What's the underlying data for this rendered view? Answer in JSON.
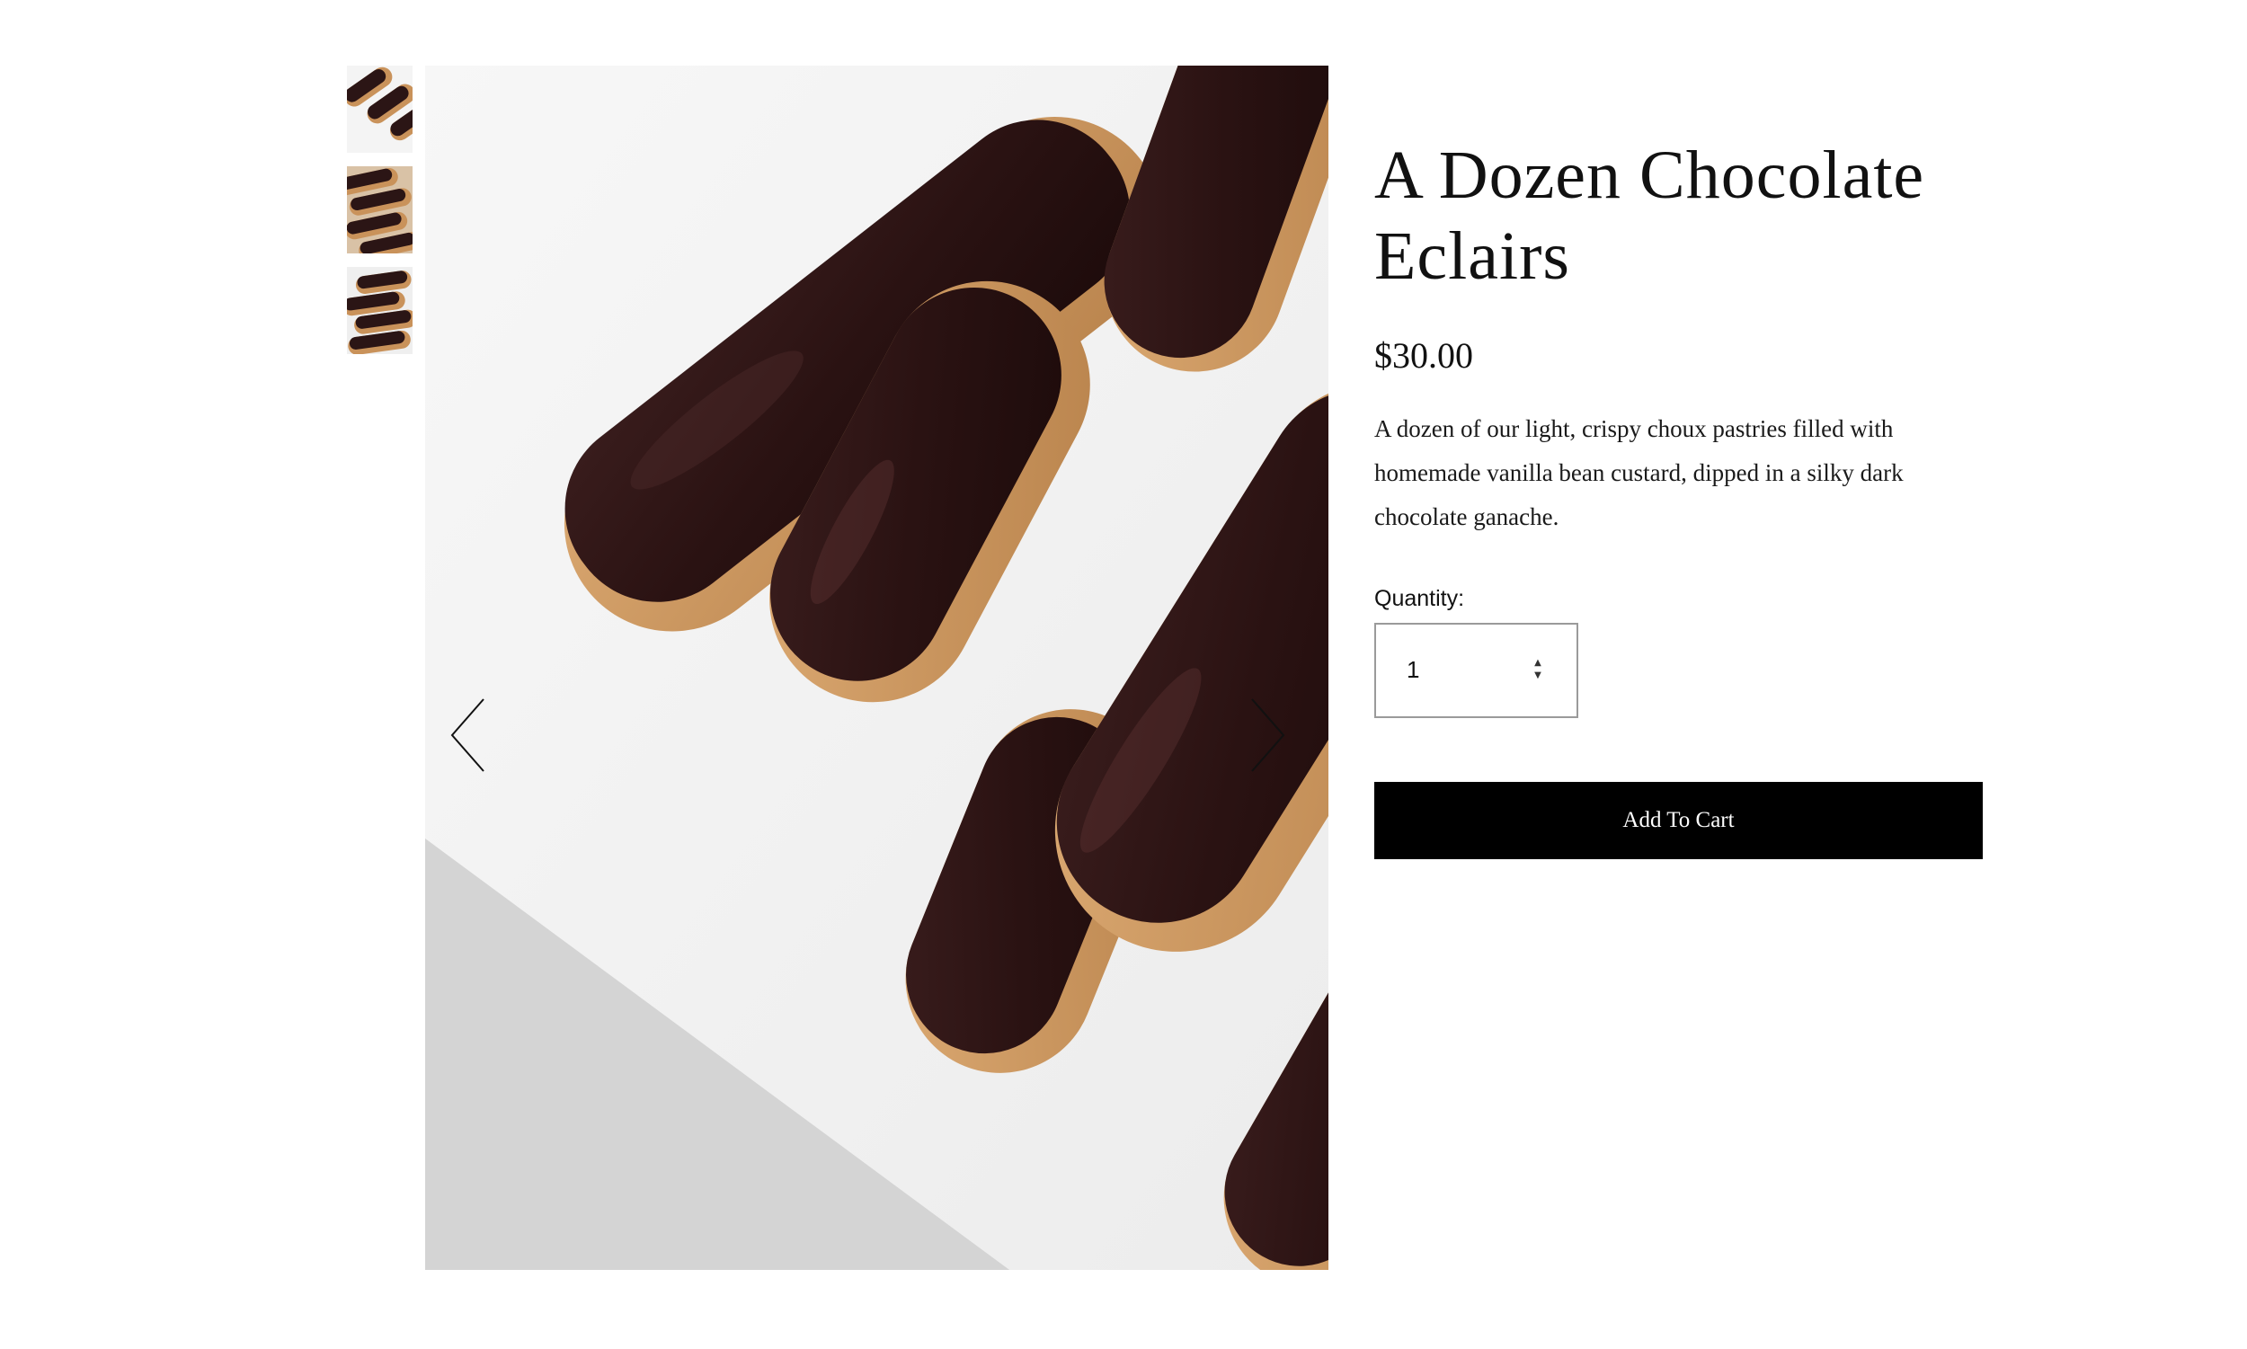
{
  "gallery": {
    "thumbnails": [
      {
        "icon": "eclair-thumbnail-1"
      },
      {
        "icon": "eclair-thumbnail-2"
      },
      {
        "icon": "eclair-thumbnail-3"
      }
    ],
    "main_image": "chocolate-eclairs-photo",
    "prev_icon": "chevron-left-icon",
    "next_icon": "chevron-right-icon"
  },
  "product": {
    "title_line1": "A Dozen Chocolate",
    "title_line2": "Eclairs",
    "price": "$30.00",
    "description": "A dozen of our light, crispy choux pastries filled with homemade vanilla bean custard, dipped in a silky dark chocolate ganache.",
    "quantity_label": "Quantity:",
    "quantity_value": "1",
    "add_to_cart_label": "Add To Cart"
  },
  "colors": {
    "button_bg": "#000000",
    "chocolate": "#2a1414",
    "pastry": "#c9925a",
    "plate": "#f2f2f2"
  }
}
